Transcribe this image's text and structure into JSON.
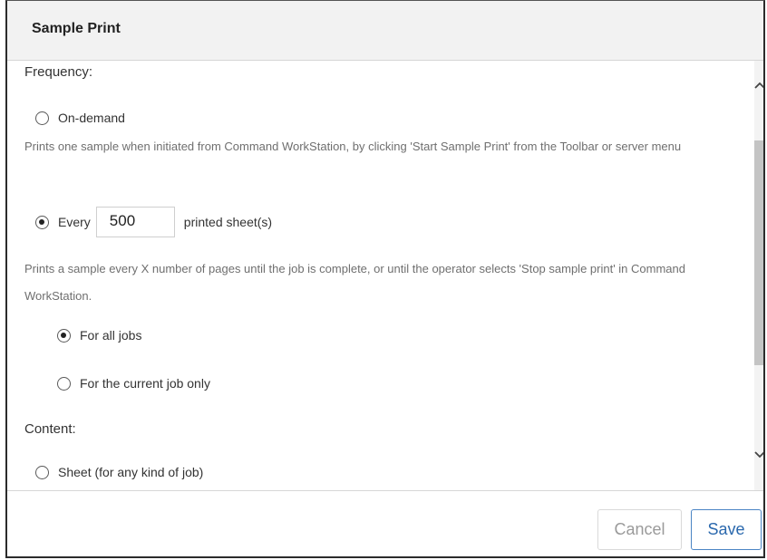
{
  "dialog": {
    "title": "Sample Print"
  },
  "frequency": {
    "label": "Frequency:",
    "on_demand": {
      "label": "On-demand",
      "checked": false,
      "description": "Prints one sample when initiated from Command WorkStation, by clicking 'Start Sample Print' from the Toolbar or server menu"
    },
    "every": {
      "label": "Every",
      "checked": true,
      "value": "500",
      "suffix": "printed sheet(s)",
      "description": "Prints a sample every X number of pages until the job is complete, or until the operator selects 'Stop sample print' in Command WorkStation."
    },
    "scope": {
      "all_jobs": {
        "label": "For all jobs",
        "checked": true
      },
      "current_job": {
        "label": "For the current job only",
        "checked": false
      }
    }
  },
  "content": {
    "label": "Content:",
    "sheet": {
      "label": "Sheet (for any kind of job)",
      "checked": false
    }
  },
  "footer": {
    "cancel_label": "Cancel",
    "save_label": "Save"
  },
  "icons": {
    "scroll_up": "chevron-up-icon",
    "scroll_down": "chevron-down-icon"
  }
}
